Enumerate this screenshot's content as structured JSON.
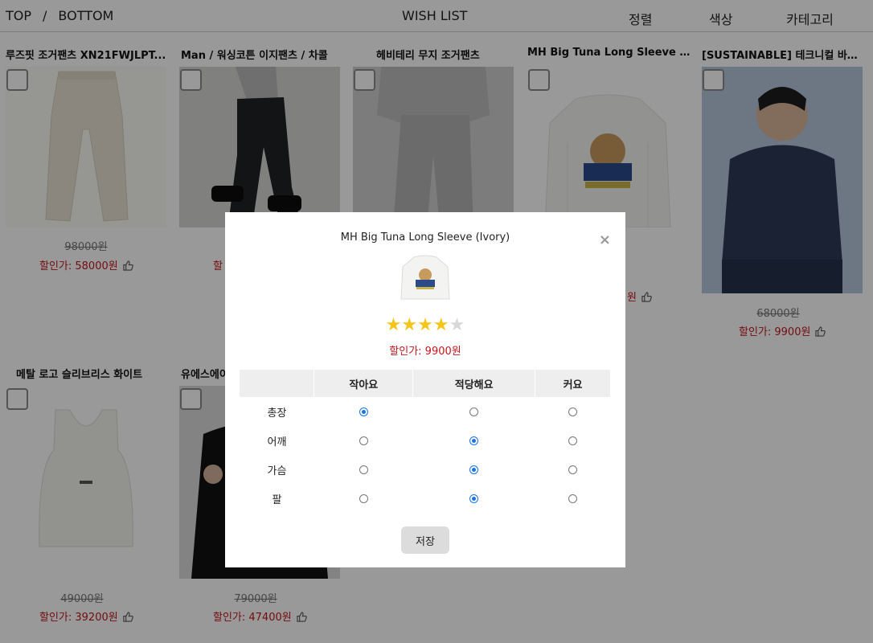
{
  "header": {
    "top": "TOP",
    "slash": "/",
    "bottom": "BOTTOM",
    "title": "WISH LIST",
    "sort": "정렬",
    "color": "색상",
    "category": "카테고리"
  },
  "products": [
    {
      "name": "루즈핏 조거팬츠 XN21FWJLPT...",
      "original_price": "98000원",
      "sale_price": "할인가: 58000원",
      "image": "ivory-jogger-pants-photo"
    },
    {
      "name": "Man / 워싱코튼 이지팬츠 / 차콜",
      "original_price": "",
      "sale_price": "할",
      "image": "charcoal-easy-pants-model-photo"
    },
    {
      "name": "헤비테리 무지 조거팬츠",
      "original_price": "",
      "sale_price": "",
      "image": "grey-jogger-pants-model-photo"
    },
    {
      "name": "MH Big Tuna Long Sleeve (Iv...",
      "original_price": "",
      "sale_price": "원",
      "image": "big-tuna-sweatshirt-photo"
    },
    {
      "name": "[SUSTAINABLE] 테크니컬 바이...",
      "original_price": "68000원",
      "sale_price": "할인가: 9900원",
      "image": "navy-hoodie-model-photo"
    },
    {
      "name": "메탈 로고 슬리브리스 화이트",
      "original_price": "49000원",
      "sale_price": "할인가: 39200원",
      "image": "white-sleeveless-top-photo"
    },
    {
      "name": "유에스에이",
      "original_price": "79000원",
      "sale_price": "할인가: 47400원",
      "image": "black-jacket-model-photo"
    }
  ],
  "modal": {
    "title": "MH Big Tuna Long Sleeve (Ivory)",
    "close": "×",
    "rating": 4,
    "rating_max": 5,
    "price": "할인가: 9900원",
    "columns": [
      "",
      "작아요",
      "적당해요",
      "커요"
    ],
    "rows": [
      {
        "label": "총장",
        "selected": 0
      },
      {
        "label": "어깨",
        "selected": 1
      },
      {
        "label": "가슴",
        "selected": 1
      },
      {
        "label": "팔",
        "selected": 1
      }
    ],
    "save": "저장"
  },
  "colors": {
    "sale": "#c4161c",
    "star": "#f5c518",
    "radio_checked": "#1a73e8"
  }
}
